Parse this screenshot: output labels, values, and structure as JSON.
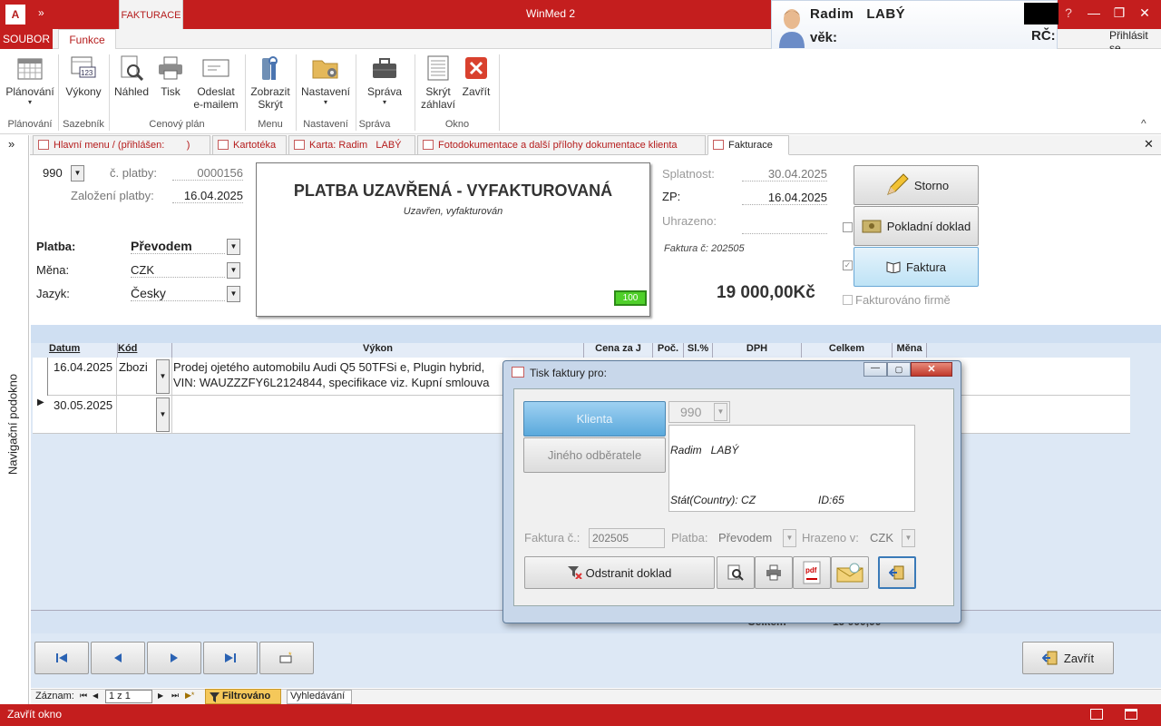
{
  "titlebar": {
    "app_icon": "A",
    "qat": "»",
    "context_tab": "FAKTURACE",
    "title": "WinMed 2",
    "help": "?",
    "minimize": "—",
    "restore": "❐",
    "close": "✕"
  },
  "user": {
    "name": "Radim   LABÝ",
    "age_label": "věk:",
    "rc_label": "RČ:",
    "sign_in": "Přihlásit se"
  },
  "menu": {
    "file": "SOUBOR",
    "tab": "Funkce"
  },
  "ribbon": {
    "buttons": [
      {
        "label": "Plánování",
        "sub": "▾"
      },
      {
        "label": "Výkony"
      },
      {
        "label": "Náhled"
      },
      {
        "label": "Tisk"
      },
      {
        "label": "Odeslat",
        "sub": "e-mailem"
      },
      {
        "label": "Zobrazit",
        "sub": "Skrýt"
      },
      {
        "label": "Nastavení",
        "sub": "▾"
      },
      {
        "label": "Správa",
        "sub": "▾"
      },
      {
        "label": "Skrýt",
        "sub": "záhlaví"
      },
      {
        "label": "Zavřít"
      }
    ],
    "groups": [
      "Plánování",
      "Sazebník",
      "Cenový plán",
      "Menu",
      "Nastavení",
      "Správa",
      "Okno"
    ],
    "collapse": "^"
  },
  "nav": {
    "toggle": "»",
    "label": "Navigační podokno"
  },
  "tabs": [
    {
      "label": "Hlavní menu / (přihlášen:        )"
    },
    {
      "label": "Kartotéka"
    },
    {
      "label": "Karta: Radim   LABÝ"
    },
    {
      "label": "Fotodokumentace a další přílohy dokumentace klienta"
    },
    {
      "label": "Fakturace"
    }
  ],
  "tabs_close": "✕",
  "form": {
    "number": "990",
    "c_platby_label": "č. platby:",
    "c_platby": "0000156",
    "zalozeni_label": "Založení platby:",
    "zalozeni": "16.04.2025",
    "platba_label": "Platba:",
    "platba": "Převodem",
    "mena_label": "Měna:",
    "mena": "CZK",
    "jazyk_label": "Jazyk:",
    "jazyk": "Česky",
    "status_title": "PLATBA UZAVŘENÁ - VYFAKTUROVANÁ",
    "status_sub": "Uzavřen, vyfakturován",
    "badge": "100",
    "splatnost_label": "Splatnost:",
    "splatnost": "30.04.2025",
    "zp_label": "ZP:",
    "zp": "16.04.2025",
    "uhrazeno_label": "Uhrazeno:",
    "faktura_c": "Faktura č: 202505",
    "total": "19 000,00Kč",
    "btn_storno": "Storno",
    "btn_pokladni": "Pokladní doklad",
    "btn_faktura": "Faktura",
    "fakturovano_label": "Fakturováno firmě"
  },
  "grid": {
    "headers": [
      "Datum",
      "Kód",
      "Výkon",
      "Cena za J",
      "Poč.",
      "Sl.%",
      "DPH",
      "Celkem",
      "Měna"
    ],
    "rows": [
      {
        "datum": "16.04.2025",
        "kod": "Zbozi",
        "vykon1": "Prodej ojetého automobilu Audi Q5 50TFSi e, Plugin hybrid,",
        "vykon2": "VIN: WAUZZZFY6L2124844, specifikace viz. Kupní smlouva"
      },
      {
        "datum": "30.05.2025",
        "kod": ""
      }
    ],
    "footer_label": "Celkem",
    "footer_value": "19 000,00"
  },
  "bottom": {
    "close": "Zavřít"
  },
  "recnav": {
    "label": "Záznam:",
    "first": "⏮",
    "prev": "◀",
    "current": "1 z 1",
    "next": "▶",
    "last": "⏭",
    "new": "▶*",
    "filter": "Filtrováno",
    "search": "Vyhledávání"
  },
  "statusbar": {
    "text": "Zavřít okno"
  },
  "dialog": {
    "title": "Tisk faktury pro:",
    "btn_klienta": "Klienta",
    "btn_jiny": "Jiného odběratele",
    "number": "990",
    "addr_name": "Radim   LABÝ",
    "addr_country": "Stát(Country): CZ",
    "addr_id": "ID:65",
    "faktura_label": "Faktura č.:",
    "faktura": "202505",
    "platba_label": "Platba:",
    "platba": "Převodem",
    "hrazeno_label": "Hrazeno v:",
    "hrazeno": "CZK",
    "btn_remove": "Odstranit doklad"
  }
}
